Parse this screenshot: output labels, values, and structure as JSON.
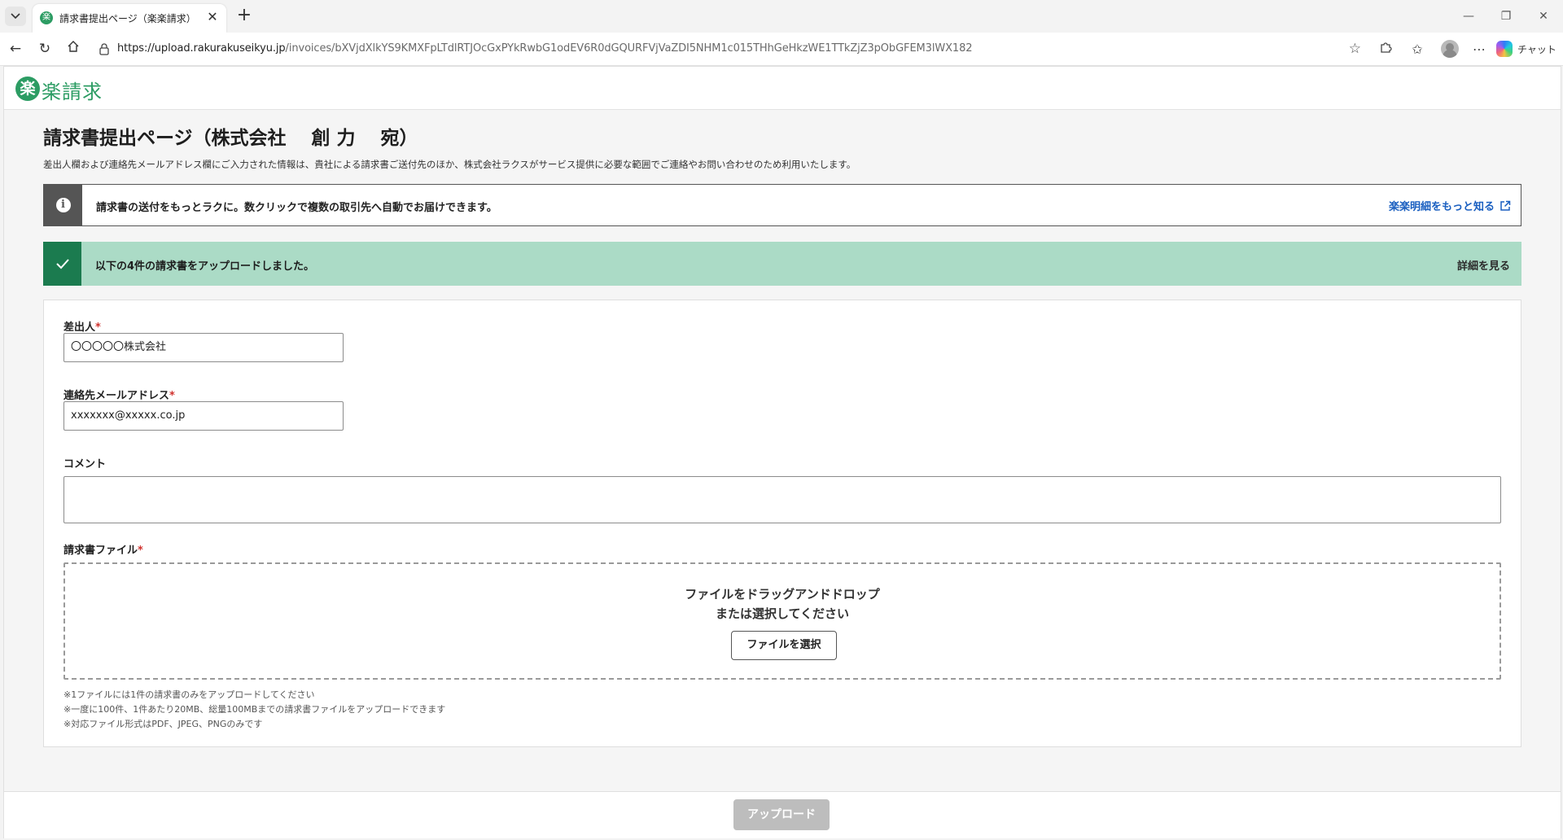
{
  "browser": {
    "tab_title": "請求書提出ページ（楽楽請求）",
    "tab_favicon": "楽",
    "url_host": "https://upload.rakurakuseikyu.jp",
    "url_path": "/invoices/bXVjdXlkYS9KMXFpLTdlRTJOcGxPYkRwbG1odEV6R0dGQURFVjVaZDI5NHM1c015THhGeHkzWE1TTkZjZ3pObGFEM3lWX182",
    "chat_label": "チャット"
  },
  "header": {
    "logo_mark": "楽",
    "logo_text": "楽請求"
  },
  "page": {
    "title": "請求書提出ページ（株式会社　 創 力　 宛）",
    "description": "差出人欄および連絡先メールアドレス欄にご入力された情報は、貴社による請求書ご送付先のほか、株式会社ラクスがサービス提供に必要な範囲でご連絡やお問い合わせのため利用いたします。"
  },
  "info_banner": {
    "icon": "info-icon",
    "text": "請求書の送付をもっとラクに。数クリックで複数の取引先へ自動でお届けできます。",
    "link_label": "楽楽明細をもっと知る"
  },
  "success_banner": {
    "icon": "check-icon",
    "text": "以下の4件の請求書をアップロードしました。",
    "detail_label": "詳細を見る"
  },
  "form": {
    "sender": {
      "label": "差出人",
      "required_mark": "*",
      "value": "〇〇〇〇〇株式会社"
    },
    "email": {
      "label": "連絡先メールアドレス",
      "required_mark": "*",
      "value": "xxxxxxx@xxxxx.co.jp"
    },
    "comment": {
      "label": "コメント",
      "value": ""
    },
    "file": {
      "label": "請求書ファイル",
      "required_mark": "*",
      "drop_line1": "ファイルをドラッグアンドドロップ",
      "drop_line2": "または選択してください",
      "select_button": "ファイルを選択"
    },
    "notes": [
      "※1ファイルには1件の請求書のみをアップロードしてください",
      "※一度に100件、1件あたり20MB、総量100MBまでの請求書ファイルをアップロードできます",
      "※対応ファイル形式はPDF、JPEG、PNGのみです"
    ]
  },
  "footer": {
    "upload_button": "アップロード"
  },
  "colors": {
    "brand_green": "#2c9c63",
    "success_bg": "#abdbc6",
    "success_icon_bg": "#1b7b4f",
    "info_icon_bg": "#555555",
    "link_blue": "#1a5fc0",
    "required_red": "#d0312d",
    "disabled_button": "#bdbdbd"
  }
}
